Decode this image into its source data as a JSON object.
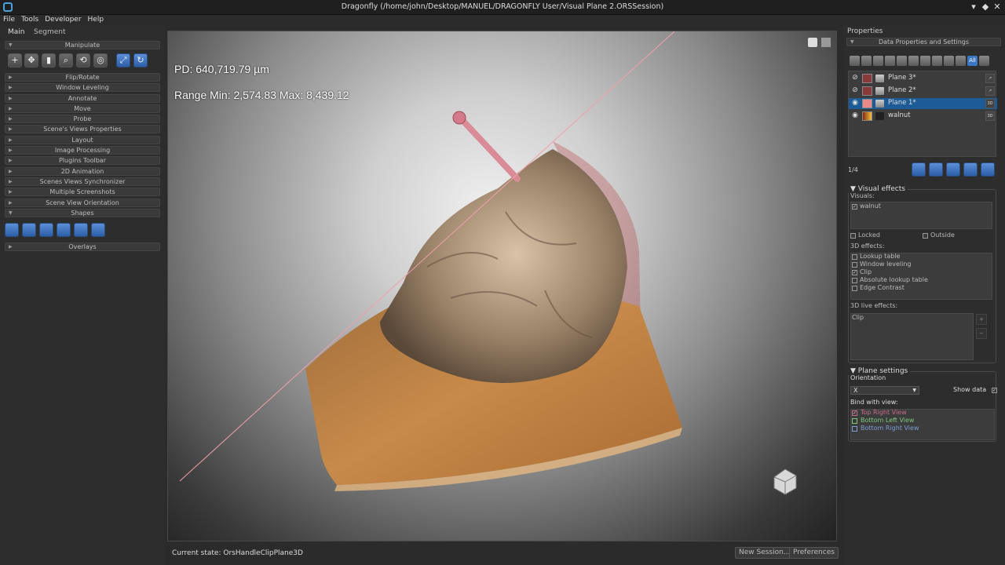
{
  "window": {
    "title": "Dragonfly (/home/john/Desktop/MANUEL/DRAGONFLY User/Visual Plane 2.ORSSession)",
    "controls": [
      "▾",
      "◆",
      "✕"
    ]
  },
  "menu": [
    "File",
    "Tools",
    "Developer",
    "Help"
  ],
  "left_panel": {
    "tabs": [
      "Main",
      "Segment"
    ],
    "manipulate_label": "Manipulate",
    "sections": [
      "Flip/Rotate",
      "Window Leveling",
      "Annotate",
      "Move",
      "Probe",
      "Scene's Views Properties",
      "Layout",
      "Image Processing",
      "Plugins Toolbar",
      "2D Animation",
      "Scenes Views Synchronizer",
      "Multiple Screenshots",
      "Scene View Orientation"
    ],
    "shapes_label": "Shapes",
    "overlays_label": "Overlays"
  },
  "viewport": {
    "pd_text": "PD: 640,719.79 µm",
    "range_text": "Range Min: 2,574.83 Max: 8,439.12"
  },
  "status": {
    "current_state": "Current state: OrsHandleClipPlane3D",
    "new_session": "New Session...",
    "preferences": "Preferences"
  },
  "properties": {
    "header": "Properties",
    "data_props": "Data Properties and Settings",
    "filter_all": "All",
    "objects": [
      {
        "name": "Plane 3*",
        "color": "#8a3a3a",
        "tag": "↗"
      },
      {
        "name": "Plane 2*",
        "color": "#8a3a3a",
        "tag": "↗"
      },
      {
        "name": "Plane 1*",
        "color": "#e88a8a",
        "tag": "3D"
      },
      {
        "name": "walnut",
        "color": "#d08020",
        "tag": "3D"
      }
    ],
    "count": "1/4",
    "visual_effects": {
      "title": "Visual effects",
      "visuals_label": "Visuals:",
      "visual_item": "walnut",
      "locked": "Locked",
      "outside": "Outside",
      "effects_label": "3D effects:",
      "effects": [
        "Lookup table",
        "Window leveling",
        "Clip",
        "Absolute lookup table",
        "Edge Contrast"
      ],
      "live_label": "3D live effects:",
      "live_item": "Clip"
    },
    "plane_settings": {
      "title": "Plane settings",
      "orientation_label": "Orientation",
      "orientation_value": "X",
      "show_data": "Show data",
      "bind_label": "Bind with view:",
      "views": [
        {
          "label": "Top Right View",
          "color": "#c86b8a"
        },
        {
          "label": "Bottom Left View",
          "color": "#7ec87e"
        },
        {
          "label": "Bottom Right View",
          "color": "#7a9ed6"
        }
      ]
    }
  }
}
